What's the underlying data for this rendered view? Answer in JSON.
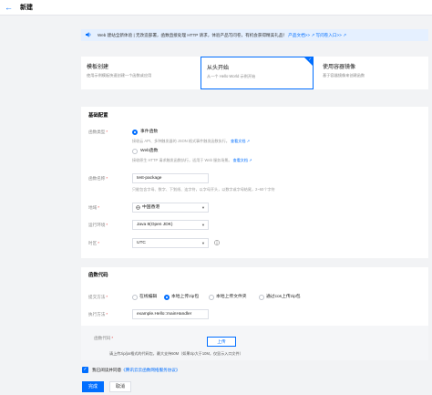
{
  "header": {
    "back_icon": "arrow-left-icon",
    "title": "新建"
  },
  "notice": {
    "icon": "speaker-icon",
    "text": "Web 建站全新体验 | 无改造部署，函数直接处理 HTTP 请求，体验产品写问卷，有机会获得精美礼品！",
    "link1": "产品文档>>",
    "link2": "写问卷入口>>"
  },
  "cards": [
    {
      "title": "模板创建",
      "desc": "使用示例模板快速创建一个函数或应用"
    },
    {
      "title": "从头开始",
      "desc": "从一个 Hello World 示例开始",
      "selected": true
    },
    {
      "title": "使用容器镜像",
      "desc": "基于容器镜像来创建函数"
    }
  ],
  "basic": {
    "section_title": "基础配置",
    "func_type": {
      "label": "函数类型",
      "option1": "事件函数",
      "option1_desc": "接收云 API、多种触发器的 JSON 格式事件触发函数执行。",
      "option1_link": "查看文档",
      "option2": "Web函数",
      "option2_desc": "接收原生 HTTP 请求触发函数执行，适用于 Web 服务场景。",
      "option2_link": "查看文档"
    },
    "func_name": {
      "label": "函数名称",
      "value": "test-package",
      "hint": "只能包含字母、数字、下划线、连字符，以字母开头，以数字或字母结尾，2~60个字符"
    },
    "region": {
      "label": "地域",
      "value": "中国香港"
    },
    "runtime": {
      "label": "运行环境",
      "value": "Java 8(Open JDK)"
    },
    "timezone": {
      "label": "时区",
      "value": "UTC"
    }
  },
  "code": {
    "section_title": "函数代码",
    "submit_method": {
      "label": "提交方法",
      "options": [
        "在线编辑",
        "本地上传zip包",
        "本地上传文件夹",
        "通过cos上传zip包"
      ],
      "selected_index": 1
    },
    "handler": {
      "label": "执行方法",
      "value": "example.Hello::mainHandler"
    },
    "package": {
      "label": "函数代码",
      "upload_label": "上传",
      "hint": "请上传zip/jar格式的代码包，最大支持50M（如果zip大于10M，仅显示入口文件）"
    }
  },
  "agreement": {
    "prefix": "我已阅读并同意",
    "link": "《腾讯云云函数网络服务协议》"
  },
  "footer": {
    "submit_label": "完成",
    "cancel_label": "取消"
  },
  "colors": {
    "accent": "#006eff",
    "notice_bg": "#e5f0ff",
    "page_bg": "#f2f3f5"
  }
}
